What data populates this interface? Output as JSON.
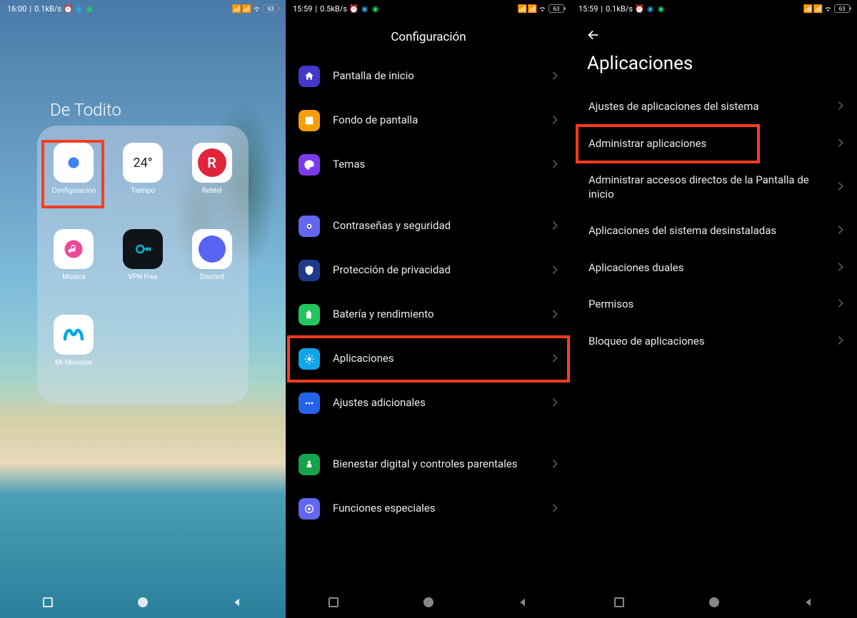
{
  "panel1": {
    "status": {
      "time": "16:00",
      "rate": "0.1kB/s",
      "battery": "63"
    },
    "folder_title": "De Todito",
    "apps": [
      {
        "name": "config",
        "label": "Configuración"
      },
      {
        "name": "weather",
        "label": "Tiempo",
        "badge": "24°"
      },
      {
        "name": "rebtel",
        "label": "Rebtel"
      },
      {
        "name": "music",
        "label": "Música"
      },
      {
        "name": "vpn",
        "label": "VPN Free"
      },
      {
        "name": "discord",
        "label": "Discord"
      },
      {
        "name": "movistar",
        "label": "Mi Movistar"
      }
    ]
  },
  "panel2": {
    "status": {
      "time": "15:59",
      "rate": "0.5kB/s",
      "battery": "63"
    },
    "title": "Configuración",
    "rows": [
      {
        "name": "home",
        "label": "Pantalla de inicio"
      },
      {
        "name": "wall",
        "label": "Fondo de pantalla"
      },
      {
        "name": "theme",
        "label": "Temas"
      },
      {
        "gap": true
      },
      {
        "name": "pass",
        "label": "Contraseñas y seguridad"
      },
      {
        "name": "priv",
        "label": "Protección de privacidad"
      },
      {
        "name": "batt",
        "label": "Batería y rendimiento"
      },
      {
        "name": "apps",
        "label": "Aplicaciones",
        "highlight": true
      },
      {
        "name": "add",
        "label": "Ajustes adicionales"
      },
      {
        "gap": true
      },
      {
        "name": "well",
        "label": "Bienestar digital y controles parentales"
      },
      {
        "name": "func",
        "label": "Funciones especiales"
      }
    ]
  },
  "panel3": {
    "status": {
      "time": "15:59",
      "rate": "0.1kB/s",
      "battery": "63"
    },
    "title": "Aplicaciones",
    "rows": [
      {
        "name": "system-settings",
        "label": "Ajustes de aplicaciones del sistema"
      },
      {
        "name": "manage-apps",
        "label": "Administrar aplicaciones",
        "highlight": true
      },
      {
        "name": "shortcuts",
        "label": "Administrar accesos directos de la Pantalla de inicio"
      },
      {
        "name": "uninstalled",
        "label": "Aplicaciones del sistema desinstaladas"
      },
      {
        "name": "dual",
        "label": "Aplicaciones duales"
      },
      {
        "name": "permissions",
        "label": "Permisos"
      },
      {
        "name": "lock",
        "label": "Bloqueo de aplicaciones"
      }
    ]
  }
}
